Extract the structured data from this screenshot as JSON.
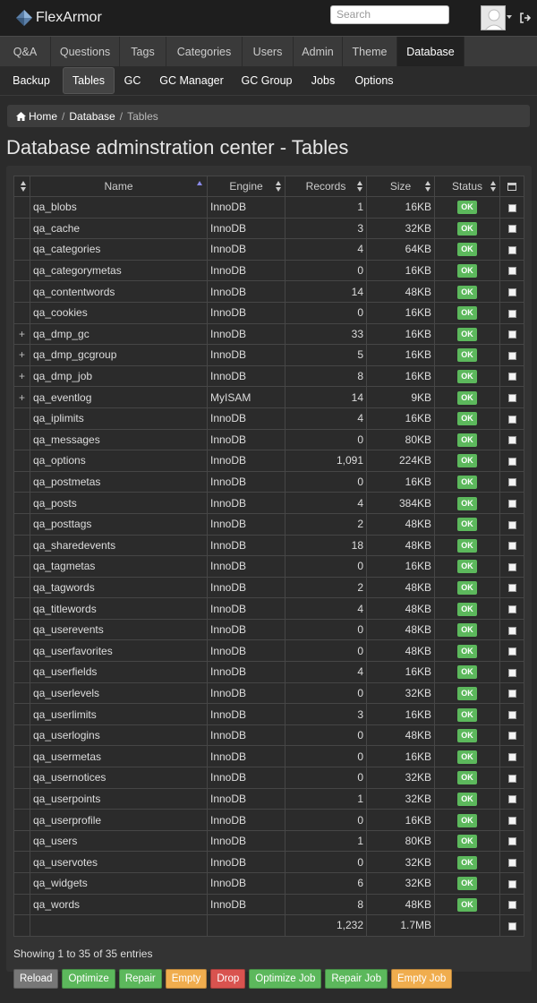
{
  "header": {
    "brand": "FlexArmor",
    "search_placeholder": "Search"
  },
  "nav": {
    "main": [
      "Q&A",
      "Questions",
      "Tags",
      "Categories",
      "Users",
      "Admin",
      "Theme",
      "Database"
    ],
    "main_active": "Database",
    "sub": [
      "Backup",
      "Tables",
      "GC",
      "GC Manager",
      "GC Group",
      "Jobs",
      "Options"
    ],
    "sub_active": "Tables"
  },
  "breadcrumb": {
    "home": "Home",
    "sep": "/",
    "database": "Database",
    "current": "Tables"
  },
  "page_title": "Database adminstration center - Tables",
  "table": {
    "columns": [
      "Name",
      "Engine",
      "Records",
      "Size",
      "Status"
    ],
    "rows": [
      {
        "expand": "",
        "name": "qa_blobs",
        "engine": "InnoDB",
        "records": "1",
        "size": "16KB",
        "status": "OK"
      },
      {
        "expand": "",
        "name": "qa_cache",
        "engine": "InnoDB",
        "records": "3",
        "size": "32KB",
        "status": "OK"
      },
      {
        "expand": "",
        "name": "qa_categories",
        "engine": "InnoDB",
        "records": "4",
        "size": "64KB",
        "status": "OK"
      },
      {
        "expand": "",
        "name": "qa_categorymetas",
        "engine": "InnoDB",
        "records": "0",
        "size": "16KB",
        "status": "OK"
      },
      {
        "expand": "",
        "name": "qa_contentwords",
        "engine": "InnoDB",
        "records": "14",
        "size": "48KB",
        "status": "OK"
      },
      {
        "expand": "",
        "name": "qa_cookies",
        "engine": "InnoDB",
        "records": "0",
        "size": "16KB",
        "status": "OK"
      },
      {
        "expand": "+",
        "name": "qa_dmp_gc",
        "engine": "InnoDB",
        "records": "33",
        "size": "16KB",
        "status": "OK"
      },
      {
        "expand": "+",
        "name": "qa_dmp_gcgroup",
        "engine": "InnoDB",
        "records": "5",
        "size": "16KB",
        "status": "OK"
      },
      {
        "expand": "+",
        "name": "qa_dmp_job",
        "engine": "InnoDB",
        "records": "8",
        "size": "16KB",
        "status": "OK"
      },
      {
        "expand": "+",
        "name": "qa_eventlog",
        "engine": "MyISAM",
        "records": "14",
        "size": "9KB",
        "status": "OK"
      },
      {
        "expand": "",
        "name": "qa_iplimits",
        "engine": "InnoDB",
        "records": "4",
        "size": "16KB",
        "status": "OK"
      },
      {
        "expand": "",
        "name": "qa_messages",
        "engine": "InnoDB",
        "records": "0",
        "size": "80KB",
        "status": "OK"
      },
      {
        "expand": "",
        "name": "qa_options",
        "engine": "InnoDB",
        "records": "1,091",
        "size": "224KB",
        "status": "OK"
      },
      {
        "expand": "",
        "name": "qa_postmetas",
        "engine": "InnoDB",
        "records": "0",
        "size": "16KB",
        "status": "OK"
      },
      {
        "expand": "",
        "name": "qa_posts",
        "engine": "InnoDB",
        "records": "4",
        "size": "384KB",
        "status": "OK"
      },
      {
        "expand": "",
        "name": "qa_posttags",
        "engine": "InnoDB",
        "records": "2",
        "size": "48KB",
        "status": "OK"
      },
      {
        "expand": "",
        "name": "qa_sharedevents",
        "engine": "InnoDB",
        "records": "18",
        "size": "48KB",
        "status": "OK"
      },
      {
        "expand": "",
        "name": "qa_tagmetas",
        "engine": "InnoDB",
        "records": "0",
        "size": "16KB",
        "status": "OK"
      },
      {
        "expand": "",
        "name": "qa_tagwords",
        "engine": "InnoDB",
        "records": "2",
        "size": "48KB",
        "status": "OK"
      },
      {
        "expand": "",
        "name": "qa_titlewords",
        "engine": "InnoDB",
        "records": "4",
        "size": "48KB",
        "status": "OK"
      },
      {
        "expand": "",
        "name": "qa_userevents",
        "engine": "InnoDB",
        "records": "0",
        "size": "48KB",
        "status": "OK"
      },
      {
        "expand": "",
        "name": "qa_userfavorites",
        "engine": "InnoDB",
        "records": "0",
        "size": "48KB",
        "status": "OK"
      },
      {
        "expand": "",
        "name": "qa_userfields",
        "engine": "InnoDB",
        "records": "4",
        "size": "16KB",
        "status": "OK"
      },
      {
        "expand": "",
        "name": "qa_userlevels",
        "engine": "InnoDB",
        "records": "0",
        "size": "32KB",
        "status": "OK"
      },
      {
        "expand": "",
        "name": "qa_userlimits",
        "engine": "InnoDB",
        "records": "3",
        "size": "16KB",
        "status": "OK"
      },
      {
        "expand": "",
        "name": "qa_userlogins",
        "engine": "InnoDB",
        "records": "0",
        "size": "48KB",
        "status": "OK"
      },
      {
        "expand": "",
        "name": "qa_usermetas",
        "engine": "InnoDB",
        "records": "0",
        "size": "16KB",
        "status": "OK"
      },
      {
        "expand": "",
        "name": "qa_usernotices",
        "engine": "InnoDB",
        "records": "0",
        "size": "32KB",
        "status": "OK"
      },
      {
        "expand": "",
        "name": "qa_userpoints",
        "engine": "InnoDB",
        "records": "1",
        "size": "32KB",
        "status": "OK"
      },
      {
        "expand": "",
        "name": "qa_userprofile",
        "engine": "InnoDB",
        "records": "0",
        "size": "16KB",
        "status": "OK"
      },
      {
        "expand": "",
        "name": "qa_users",
        "engine": "InnoDB",
        "records": "1",
        "size": "80KB",
        "status": "OK"
      },
      {
        "expand": "",
        "name": "qa_uservotes",
        "engine": "InnoDB",
        "records": "0",
        "size": "32KB",
        "status": "OK"
      },
      {
        "expand": "",
        "name": "qa_widgets",
        "engine": "InnoDB",
        "records": "6",
        "size": "32KB",
        "status": "OK"
      },
      {
        "expand": "",
        "name": "qa_words",
        "engine": "InnoDB",
        "records": "8",
        "size": "48KB",
        "status": "OK"
      }
    ],
    "totals": {
      "records": "1,232",
      "size": "1.7MB"
    }
  },
  "footer": {
    "showing": "Showing 1 to 35 of 35 entries",
    "buttons": [
      {
        "label": "Reload",
        "style": "gray"
      },
      {
        "label": "Optimize",
        "style": "green"
      },
      {
        "label": "Repair",
        "style": "green"
      },
      {
        "label": "Empty",
        "style": "orange"
      },
      {
        "label": "Drop",
        "style": "red"
      },
      {
        "label": "Optimize Job",
        "style": "green"
      },
      {
        "label": "Repair Job",
        "style": "green"
      },
      {
        "label": "Empty Job",
        "style": "orange"
      }
    ]
  },
  "colors": {
    "ok_green": "#5cb85c",
    "warning_orange": "#f0ad4e",
    "danger_red": "#d9534f",
    "default_gray": "#777777"
  }
}
